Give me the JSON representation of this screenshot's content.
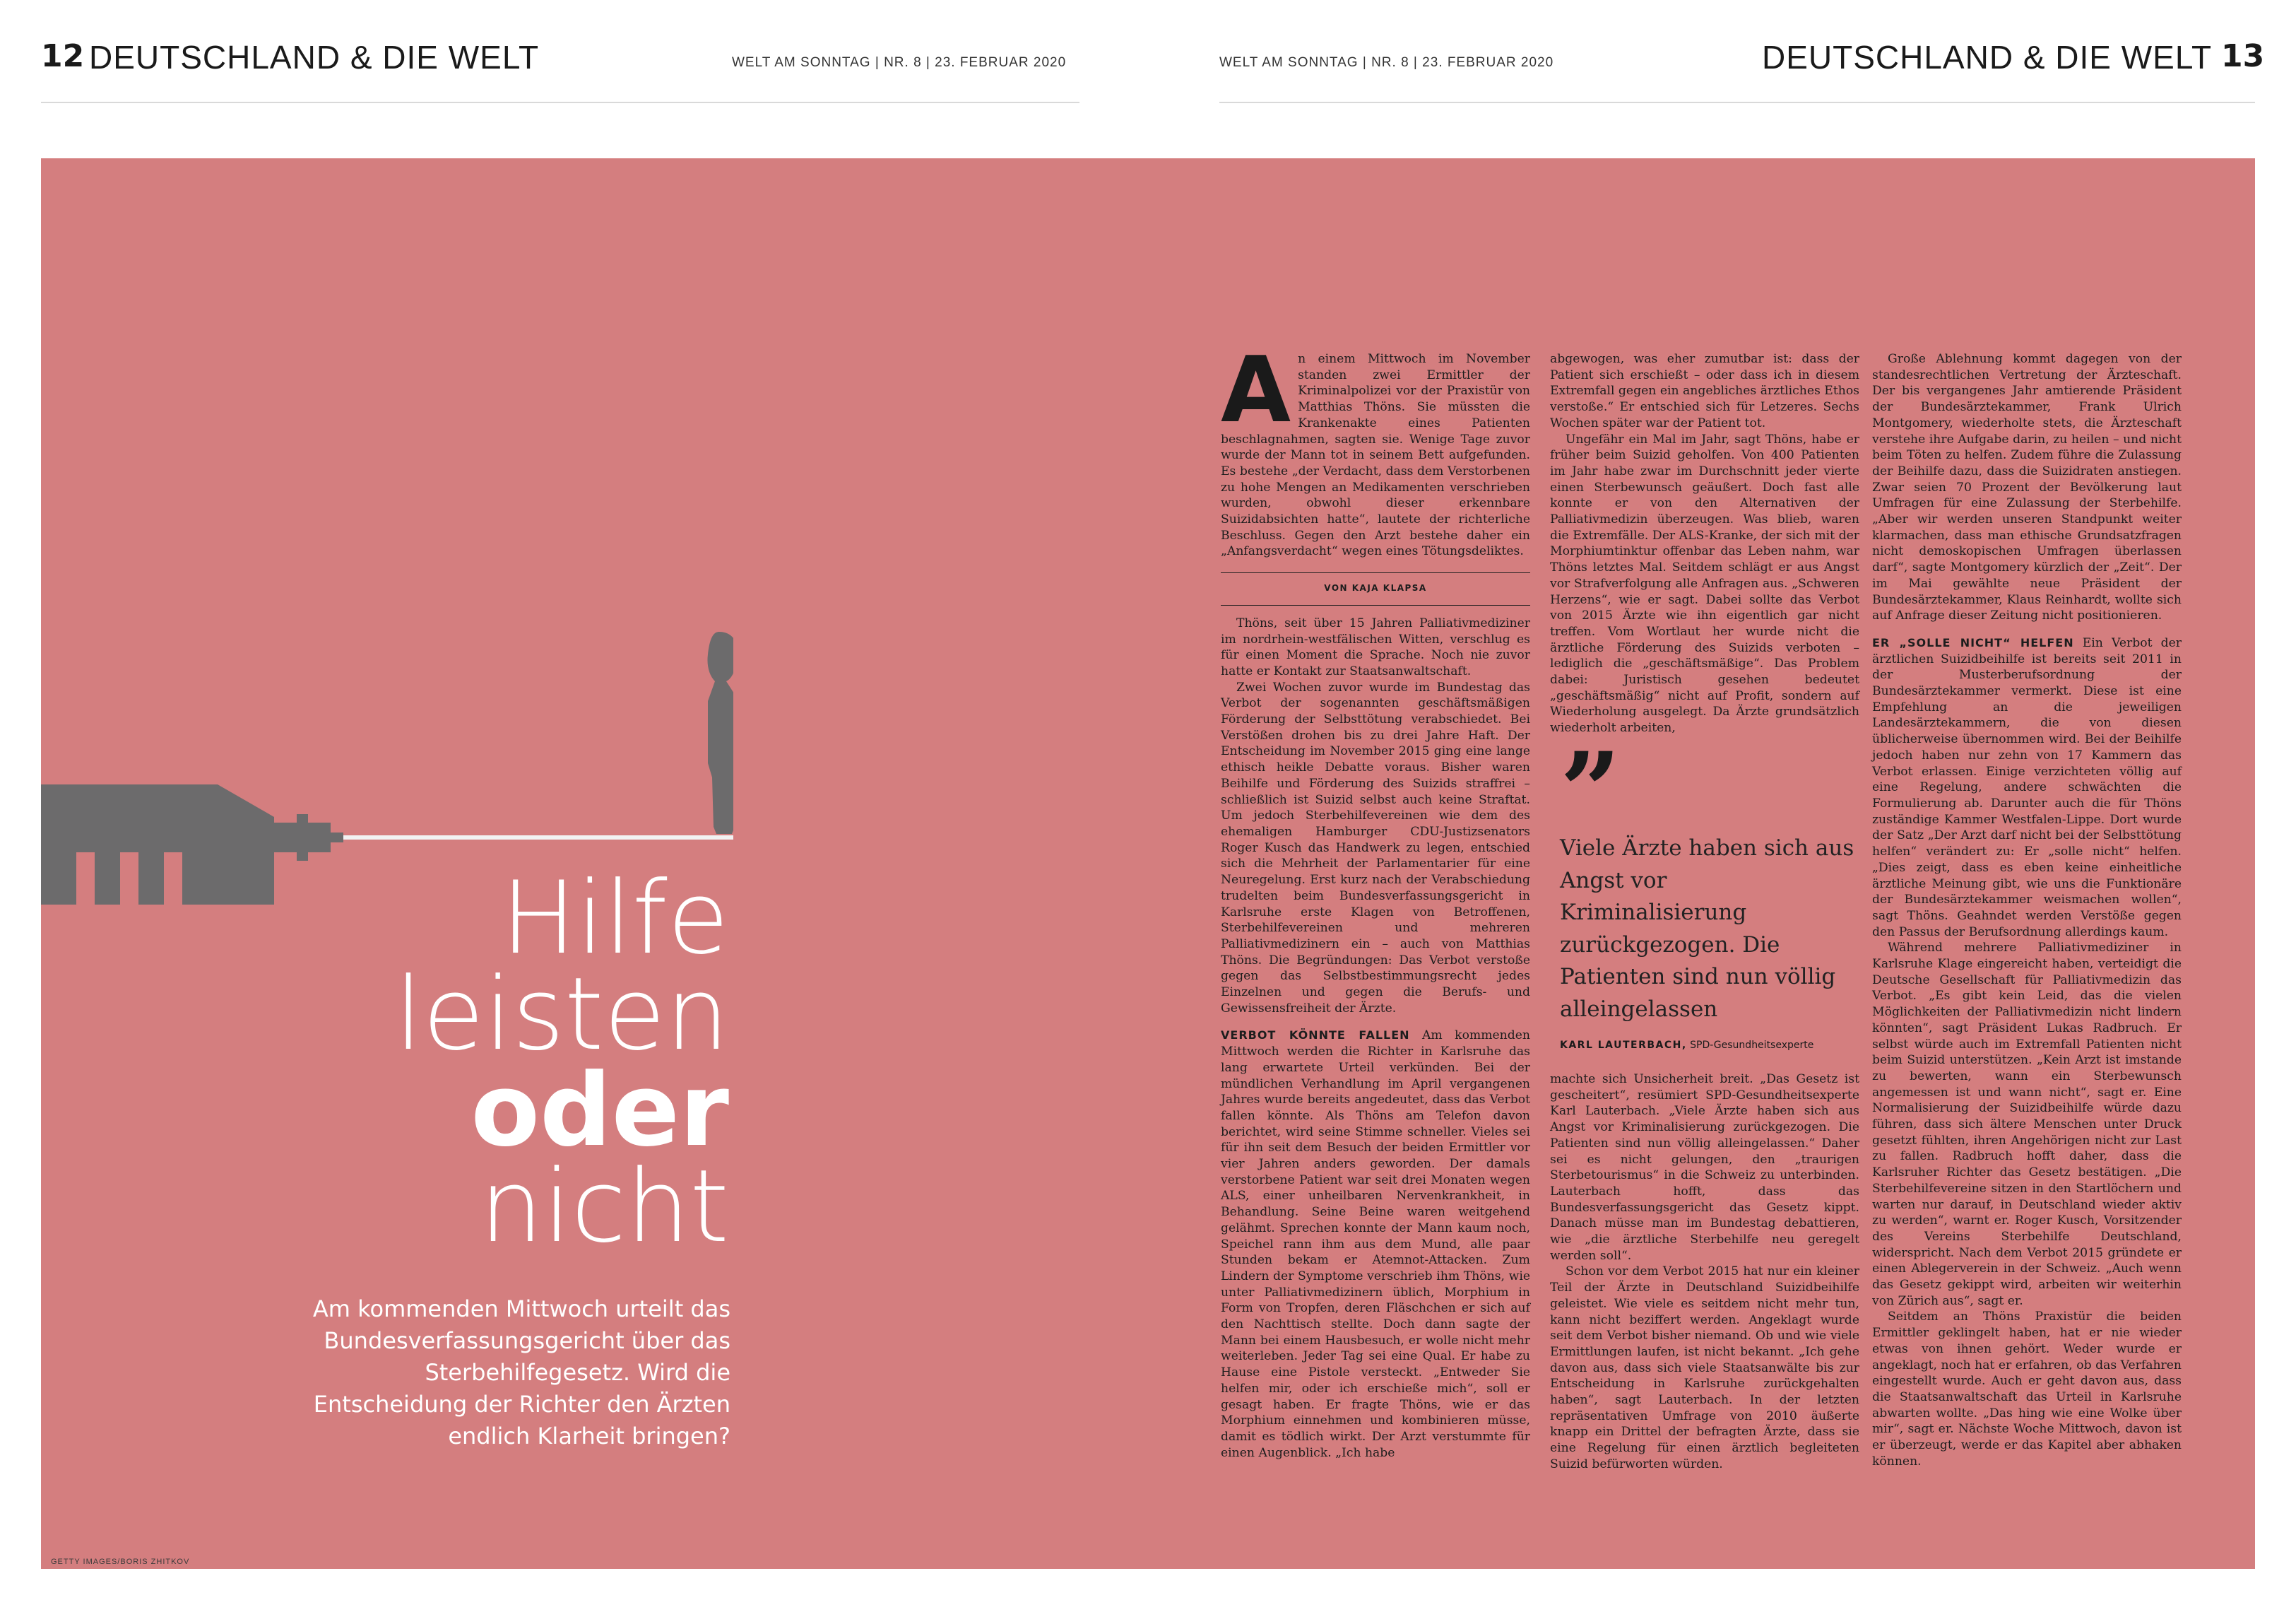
{
  "header": {
    "left_page_number": "12",
    "left_rubric": "DEUTSCHLAND & DIE WELT",
    "left_meta": "WELT AM SONNTAG  |  NR. 8  |  23. FEBRUAR 2020",
    "right_meta": "WELT AM SONNTAG  |  NR. 8  |  23. FEBRUAR 2020",
    "right_rubric": "DEUTSCHLAND & DIE WELT",
    "right_page_number": "13"
  },
  "colors": {
    "panel": "#d47e7f",
    "illustration": "#6c6b6c",
    "headline": "#ffffff"
  },
  "headline": {
    "line1": "Hilfe",
    "line2": "leisten",
    "line3": "oder",
    "line4": "nicht"
  },
  "deck": "Am kommenden Mittwoch urteilt das Bundesverfassungsgericht über das Sterbehilfegesetz. Wird die Entscheidung der Richter den Ärzten endlich Klarheit bringen?",
  "photo_credit": "GETTY IMAGES/BORIS ZHITKOV",
  "article": {
    "dropcap": "A",
    "lead": "n einem Mittwoch im November standen zwei Ermittler der Kriminalpolizei vor der Praxistür von Matthias Thöns. Sie müssten die Krankenakte eines Patienten beschlagnahmen, sagten sie. Wenige Tage zuvor wurde der Mann tot in seinem Bett aufgefunden. Es bestehe „der Verdacht, dass dem Verstorbenen zu hohe Mengen an Medikamenten verschrieben wurden, obwohl dieser erkennbare Suizidabsichten hatte“, lautete der richterliche Beschluss. Gegen den Arzt bestehe daher ein „Anfangsverdacht“ wegen eines Tötungsdeliktes.",
    "byline": "VON KAJA KLAPSA",
    "col1_paragraphs": [
      "Thöns, seit über 15 Jahren Palliativmediziner im nordrhein-westfälischen Witten, verschlug es für einen Moment die Sprache. Noch nie zuvor hatte er Kontakt zur Staatsanwaltschaft.",
      "Zwei Wochen zuvor wurde im Bundestag das Verbot der sogenannten geschäftsmäßigen Förderung der Selbsttötung verabschiedet. Bei Verstößen drohen bis zu drei Jahre Haft. Der Entscheidung im November 2015 ging eine lange ethisch heikle Debatte voraus. Bisher waren Beihilfe und Förderung des Suizids straffrei – schließlich ist Suizid selbst auch keine Straftat. Um jedoch Sterbehilfevereinen wie dem des ehemaligen Hamburger CDU-Justizsenators Roger Kusch das Handwerk zu legen, entschied sich die Mehrheit der Parlamentarier für eine Neuregelung. Erst kurz nach der Verabschiedung trudelten beim Bundesverfassungsgericht in Karlsruhe erste Klagen von Betroffenen, Sterbehilfevereinen und mehreren Palliativmedizinern ein – auch von Matthias Thöns. Die Begründungen: Das Verbot verstoße gegen das Selbstbestimmungsrecht jedes Einzelnen und gegen die Berufs- und Gewissensfreiheit der Ärzte."
    ],
    "col1_sub": "VERBOT KÖNNTE FALLEN",
    "col1_sub_text": "Am kommenden Mittwoch werden die Richter in Karlsruhe das lang erwartete Urteil verkünden. Bei der mündlichen Verhandlung im April vergangenen Jahres wurde bereits angedeutet, dass das Verbot fallen könnte. Als Thöns am Telefon davon berichtet, wird seine Stimme schneller. Vieles sei für ihn seit dem Besuch der beiden Ermittler vor vier Jahren anders geworden. Der damals verstorbene Patient war seit drei Monaten wegen ALS, einer unheilbaren Nervenkrankheit, in Behandlung. Seine Beine waren weitgehend gelähmt. Sprechen konnte der Mann kaum noch, Speichel rann ihm aus dem Mund, alle paar Stunden bekam er Atemnot-Attacken. Zum Lindern der Symptome verschrieb ihm Thöns, wie unter Palliativmedizinern üblich, Morphium in Form von Tropfen, deren Fläschchen er sich auf den Nachttisch stellte. Doch dann sagte der Mann bei einem Hausbesuch, er wolle nicht mehr weiterleben. Jeder Tag sei eine Qual. Er habe zu Hause eine Pistole versteckt. „Entweder Sie helfen mir, oder ich erschieße mich“, soll er gesagt haben. Er fragte Thöns, wie er das Morphium einnehmen und kombinieren müsse, damit es tödlich wirkt. Der Arzt verstummte für einen Augenblick. „Ich habe",
    "col2_top": [
      "abgewogen, was eher zumutbar ist: dass der Patient sich erschießt – oder dass ich in diesem Extremfall gegen ein angebliches ärztliches Ethos verstoße.“ Er entschied sich für Letzeres. Sechs Wochen später war der Patient tot.",
      "Ungefähr ein Mal im Jahr, sagt Thöns, habe er früher beim Suizid geholfen. Von 400 Patienten im Jahr habe zwar im Durchschnitt jeder vierte einen Sterbewunsch geäußert. Doch fast alle konnte er von den Alternativen der Palliativmedizin überzeugen. Was blieb, waren die Extremfälle. Der ALS-Kranke, der sich mit der Morphiumtinktur offenbar das Leben nahm, war Thöns letztes Mal. Seitdem schlägt er aus Angst vor Strafverfolgung alle Anfragen aus. „Schweren Herzens“, wie er sagt. Dabei sollte das Verbot von 2015 Ärzte wie ihn eigentlich gar nicht treffen. Vom Wortlaut her wurde nicht die ärztliche Förderung des Suizids verboten – lediglich die „geschäftsmäßige“. Das Problem dabei: Juristisch gesehen bedeutet „geschäftsmäßig“ nicht auf Profit, sondern auf Wiederholung ausgelegt. Da Ärzte grundsätzlich wiederholt arbeiten,"
    ],
    "quote": {
      "mark": "”",
      "text": "Viele Ärzte haben sich aus Angst vor Kriminalisierung zurückgezogen. Die Patienten sind nun völlig alleingelassen",
      "author": "KARL LAUTERBACH,",
      "author_role": "SPD-Gesundheitsexperte"
    },
    "col2_bottom": [
      "machte sich Unsicherheit breit. „Das Gesetz ist gescheitert“, resümiert SPD-Gesundheitsexperte Karl Lauterbach. „Viele Ärzte haben sich aus Angst vor Kriminalisierung zurückgezogen. Die Patienten sind nun völlig alleingelassen.“ Daher sei es nicht gelungen, den „traurigen Sterbetourismus“ in die Schweiz zu unterbinden. Lauterbach hofft, dass das Bundesverfassungsgericht das Gesetz kippt. Danach müsse man im Bundestag debattieren, wie „die ärztliche Sterbehilfe neu geregelt werden soll“.",
      "Schon vor dem Verbot 2015 hat nur ein kleiner Teil der Ärzte in Deutschland Suizidbeihilfe geleistet. Wie viele es seitdem nicht mehr tun, kann nicht beziffert werden. Angeklagt wurde seit dem Verbot bisher niemand. Ob und wie viele Ermittlungen laufen, ist nicht bekannt. „Ich gehe davon aus, dass sich viele Staatsanwälte bis zur Entscheidung in Karlsruhe zurückgehalten haben“, sagt Lauterbach. In der letzten repräsentativen Umfrage von 2010 äußerte knapp ein Drittel der befragten Ärzte, dass sie eine Regelung für einen ärztlich begleiteten Suizid befürworten würden."
    ],
    "col3_top": [
      "Große Ablehnung kommt dagegen von der standesrechtlichen Vertretung der Ärzteschaft. Der bis vergangenes Jahr amtierende Präsident der Bundesärztekammer, Frank Ulrich Montgomery, wiederholte stets, die Ärzteschaft verstehe ihre Aufgabe darin, zu heilen – und nicht beim Töten zu helfen. Zudem führe die Zulassung der Beihilfe dazu, dass die Suizidraten anstiegen. Zwar seien 70 Prozent der Bevölkerung laut Umfragen für eine Zulassung der Sterbehilfe. „Aber wir werden unseren Standpunkt weiter klarmachen, dass man ethische Grundsatzfragen nicht demoskopischen Umfragen überlassen darf“, sagte Montgomery kürzlich der „Zeit“. Der im Mai gewählte neue Präsident der Bundesärztekammer, Klaus Reinhardt, wollte sich auf Anfrage dieser Zeitung nicht positionieren."
    ],
    "col3_sub": "ER „SOLLE NICHT“ HELFEN",
    "col3_sub_text": "Ein Verbot der ärztlichen Suizidbeihilfe ist bereits seit 2011 in der Musterberufsordnung der Bundesärztekammer vermerkt. Diese ist eine Empfehlung an die jeweiligen Landesärztekammern, die von diesen üblicherweise übernommen wird. Bei der Beihilfe jedoch haben nur zehn von 17 Kammern das Verbot erlassen. Einige verzichteten völlig auf eine Regelung, andere schwächten die Formulierung ab. Darunter auch die für Thöns zuständige Kammer Westfalen-Lippe. Dort wurde der Satz „Der Arzt darf nicht bei der Selbsttötung helfen“ verändert zu: Er „solle nicht“ helfen. „Dies zeigt, dass es eben keine einheitliche ärztliche Meinung gibt, wie uns die Funktionäre der Bundesärztekammer weismachen wollen“, sagt Thöns. Geahndet werden Verstöße gegen den Passus der Berufsordnung allerdings kaum.",
    "col3_paragraphs": [
      "Während mehrere Palliativmediziner in Karlsruhe Klage eingereicht haben, verteidigt die Deutsche Gesellschaft für Palliativmedizin das Verbot. „Es gibt kein Leid, das die vielen Möglichkeiten der Palliativmedizin nicht lindern könnten“, sagt Präsident Lukas Radbruch. Er selbst würde auch im Extremfall Patienten nicht beim Suizid unterstützen. „Kein Arzt ist imstande zu bewerten, wann ein Sterbewunsch angemessen ist und wann nicht“, sagt er. Eine Normalisierung der Suizidbeihilfe würde dazu führen, dass sich ältere Menschen unter Druck gesetzt fühlten, ihren Angehörigen nicht zur Last zu fallen. Radbruch hofft daher, dass die Karlsruher Richter das Gesetz bestätigen. „Die Sterbehilfevereine sitzen in den Startlöchern und warten nur darauf, in Deutschland wieder aktiv zu werden“, warnt er. Roger Kusch, Vorsitzender des Vereins Sterbehilfe Deutschland, widerspricht. Nach dem Verbot 2015 gründete er einen Ablegerverein in der Schweiz. „Auch wenn das Gesetz gekippt wird, arbeiten wir weiterhin von Zürich aus“, sagt er.",
      "Seitdem an Thöns Praxistür die beiden Ermittler geklingelt haben, hat er nie wieder etwas von ihnen gehört. Weder wurde er angeklagt, noch hat er erfahren, ob das Verfahren eingestellt wurde. Auch er geht davon aus, dass die Staatsanwaltschaft das Urteil in Karlsruhe abwarten wollte. „Das hing wie eine Wolke über mir“, sagt er. Nächste Woche Mittwoch, davon ist er überzeugt, werde er das Kapitel aber abhaken können."
    ]
  }
}
